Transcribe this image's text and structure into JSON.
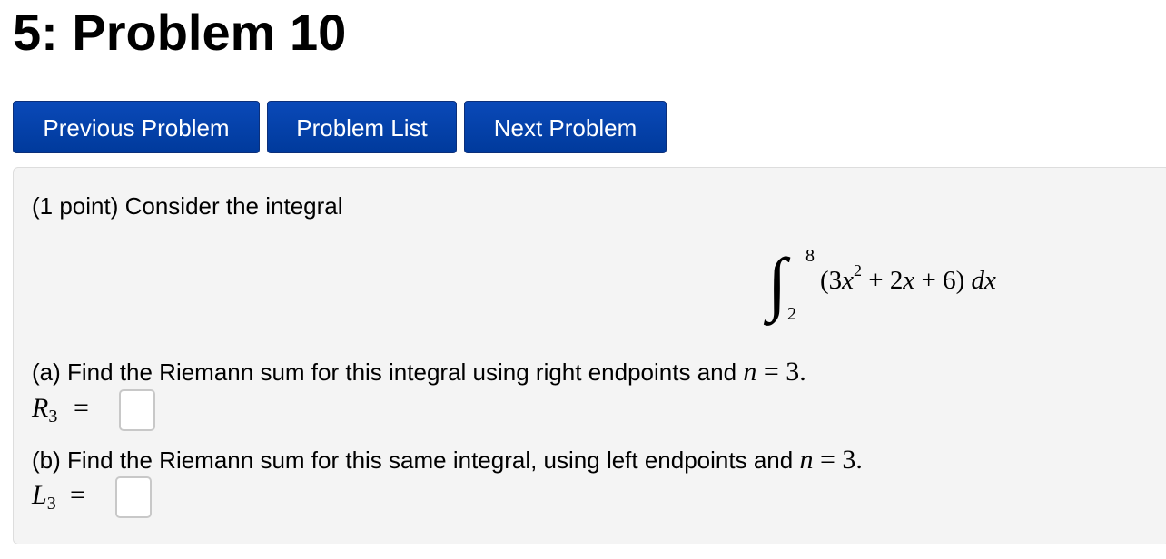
{
  "page": {
    "title": "5: Problem 10"
  },
  "nav": {
    "previous_label": "Previous Problem",
    "list_label": "Problem List",
    "next_label": "Next Problem",
    "button_color": "#0a49b8"
  },
  "problem": {
    "intro": "(1 point) Consider the integral",
    "integral": {
      "upper_limit": "8",
      "lower_limit": "2",
      "integrand_open": "(3",
      "var_x1": "x",
      "exponent": "2",
      "rest_a": " + 2",
      "var_x2": "x",
      "rest_b": " + 6) ",
      "differential": "dx"
    },
    "part_a": {
      "text": "(a) Find the Riemann sum for this integral using right endpoints and ",
      "n_var": "n",
      "n_value": " = 3.",
      "label_letter": "R",
      "label_sub": "3",
      "equals": "=",
      "answer_value": ""
    },
    "part_b": {
      "text": "(b) Find the Riemann sum for this same integral, using left endpoints and ",
      "n_var": "n",
      "n_value": " = 3.",
      "label_letter": "L",
      "label_sub": "3",
      "equals": "=",
      "answer_value": ""
    }
  }
}
